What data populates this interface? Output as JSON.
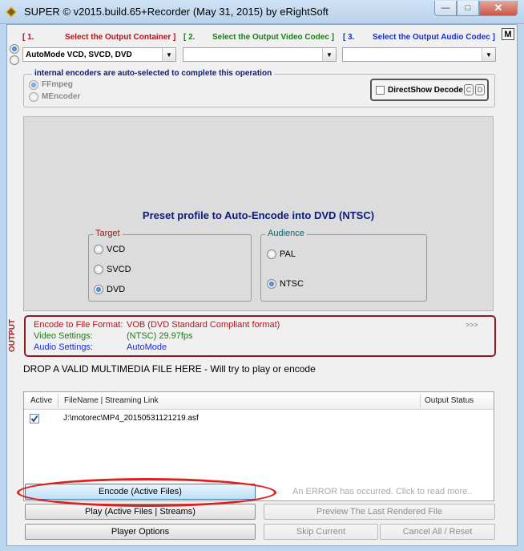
{
  "window": {
    "title": "SUPER © v2015.build.65+Recorder (May 31, 2015) by eRightSoft",
    "min_glyph": "—",
    "max_glyph": "□",
    "close_glyph": "✕"
  },
  "steps": {
    "s1_num": "[ 1.",
    "s1_label": "Select the Output Container ]",
    "s2_num": "[ 2.",
    "s2_label": "Select the Output Video Codec ]",
    "s3_num": "[ 3.",
    "s3_label": "Select the Output Audio Codec ]",
    "m_badge": "M"
  },
  "combos": {
    "container_value": "AutoMode VCD, SVCD, DVD",
    "video_value": "",
    "audio_value": "",
    "arrow": "▼"
  },
  "encoders": {
    "legend": "internal encoders are auto-selected to complete this operation",
    "ffmpeg": "FFmpeg",
    "mencoder": "MEncoder",
    "directshow": "DirectShow Decode",
    "c_badge": "C",
    "d_badge": "D"
  },
  "preset": {
    "title": "Preset profile to Auto-Encode into DVD  (NTSC)",
    "target_legend": "Target",
    "vcd": "VCD",
    "svcd": "SVCD",
    "dvd": "DVD",
    "audience_legend": "Audience",
    "pal": "PAL",
    "ntsc": "NTSC"
  },
  "output": {
    "side_label": "OUTPUT",
    "format_label": "Encode to File Format:",
    "format_value": "VOB (DVD Standard Compliant format)",
    "video_label": "Video Settings:",
    "video_value": "(NTSC) 29.97fps",
    "audio_label": "Audio Settings:",
    "audio_value": "AutoMode",
    "more": ">>>"
  },
  "drop_hint": "DROP A VALID MULTIMEDIA FILE HERE - Will try to play or encode",
  "table": {
    "col_active": "Active",
    "col_filename": "FileName  |  Streaming Link",
    "col_status": "Output Status",
    "rows": [
      {
        "checked": true,
        "filename": "J:\\motorec\\MP4_20150531121219.asf",
        "status": ""
      }
    ]
  },
  "buttons": {
    "encode": "Encode (Active Files)",
    "error_msg": "An ERROR has occurred. Click to read more..",
    "play": "Play (Active Files | Streams)",
    "preview": "Preview The Last Rendered File",
    "player_options": "Player Options",
    "skip": "Skip Current",
    "cancel": "Cancel All   /   Reset"
  },
  "colors": {
    "accent_red": "#b0141b",
    "accent_green": "#1d7a1d",
    "accent_blue": "#1a2ecc",
    "highlight_oval": "#e02020"
  }
}
